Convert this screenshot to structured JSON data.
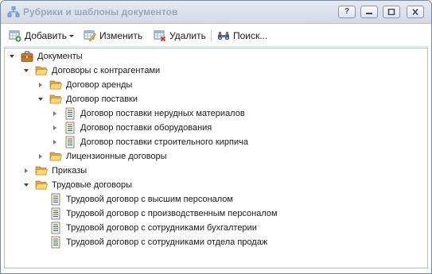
{
  "window": {
    "title": "Рубрики и шаблоны документов",
    "help_label": "?"
  },
  "toolbar": {
    "add_label": "Добавить",
    "edit_label": "Изменить",
    "delete_label": "Удалить",
    "search_label": "Поиск..."
  },
  "tree": {
    "root": "Документы",
    "contractors": "Договоры с контрагентами",
    "rent": "Договор аренды",
    "supply": "Договор поставки",
    "supply_items": [
      "Договор поставки нерудных материалов",
      "Договор поставки оборудования",
      "Договор поставки строительного кирпича"
    ],
    "licensing": "Лицензионные договоры",
    "orders": "Приказы",
    "labor": "Трудовые договоры",
    "labor_items": [
      "Трудовой договор с высшим персоналом",
      "Трудовой договор с производственным персоналом",
      "Трудовой договор с сотрудниками бухгалтерии",
      "Трудовой договор с сотрудниками отдела продаж"
    ]
  }
}
